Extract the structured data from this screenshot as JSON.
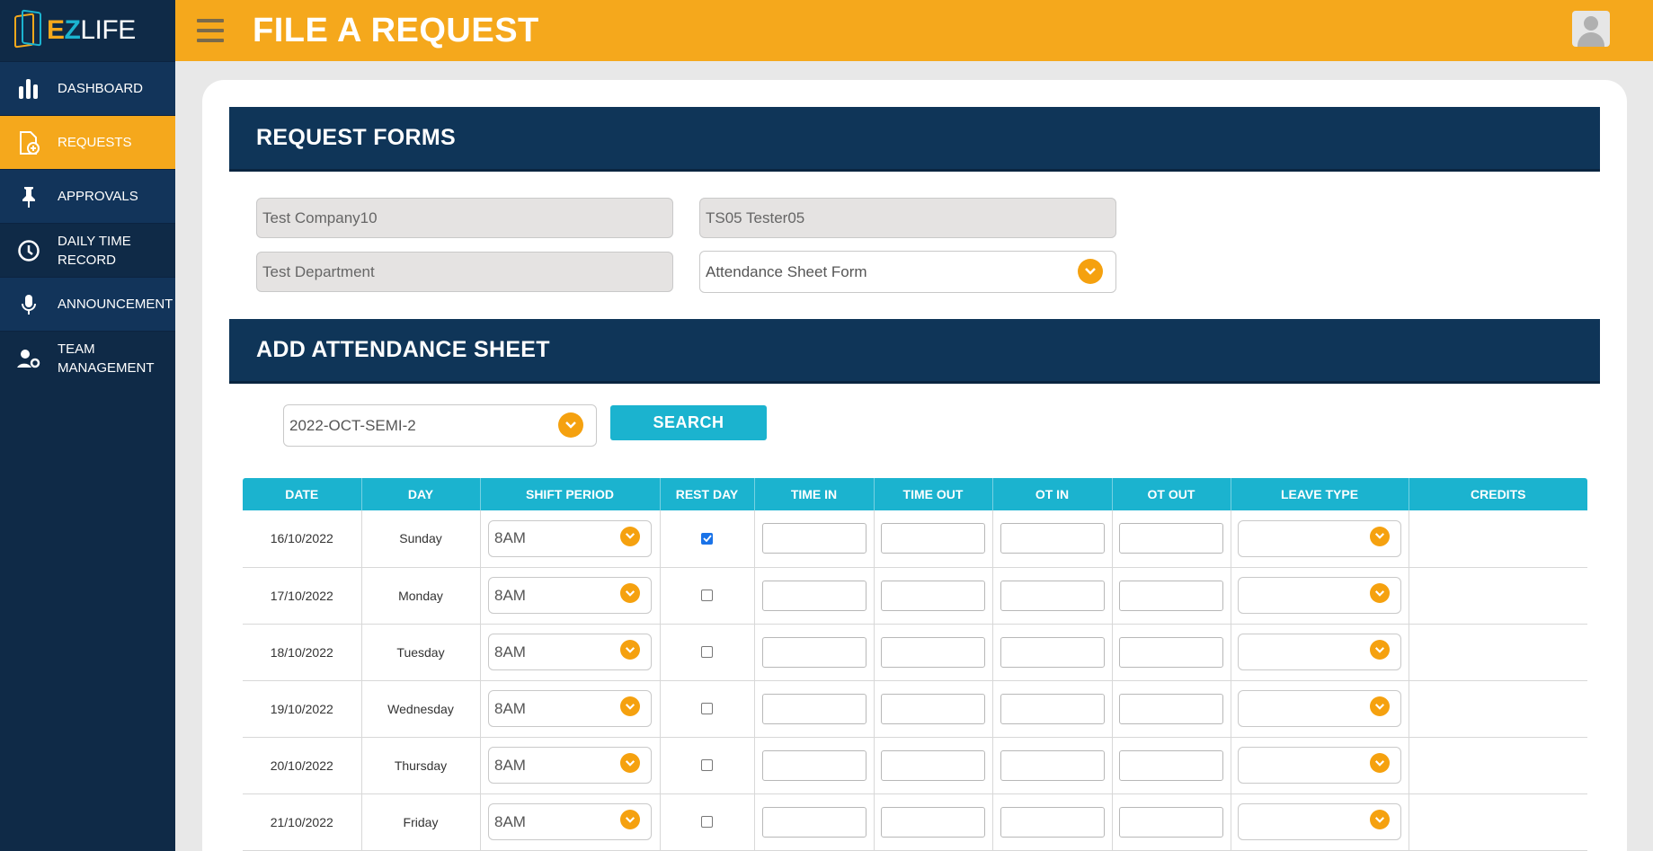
{
  "app": {
    "logo_e": "E",
    "logo_z": "Z",
    "logo_rest": "LIFE"
  },
  "header": {
    "title": "FILE A REQUEST"
  },
  "sidebar": {
    "items": [
      {
        "label": "DASHBOARD",
        "icon": "bar-chart-icon"
      },
      {
        "label": "REQUESTS",
        "icon": "document-add-icon"
      },
      {
        "label": "APPROVALS",
        "icon": "pin-icon"
      },
      {
        "label": "DAILY TIME RECORD",
        "icon": "clock-icon"
      },
      {
        "label": "ANNOUNCEMENT",
        "icon": "microphone-icon"
      },
      {
        "label": "TEAM MANAGEMENT",
        "icon": "user-gear-icon"
      }
    ]
  },
  "request_forms": {
    "title": "REQUEST FORMS",
    "company": "Test Company10",
    "employee": "TS05 Tester05",
    "department": "Test Department",
    "form_type": "Attendance Sheet Form"
  },
  "attendance": {
    "title": "ADD ATTENDANCE SHEET",
    "period": "2022-OCT-SEMI-2",
    "search_label": "SEARCH",
    "columns": [
      "DATE",
      "DAY",
      "SHIFT PERIOD",
      "REST DAY",
      "TIME IN",
      "TIME OUT",
      "OT IN",
      "OT OUT",
      "LEAVE TYPE",
      "CREDITS"
    ],
    "rows": [
      {
        "date": "16/10/2022",
        "day": "Sunday",
        "shift": "8AM",
        "rest_day": true
      },
      {
        "date": "17/10/2022",
        "day": "Monday",
        "shift": "8AM",
        "rest_day": false
      },
      {
        "date": "18/10/2022",
        "day": "Tuesday",
        "shift": "8AM",
        "rest_day": false
      },
      {
        "date": "19/10/2022",
        "day": "Wednesday",
        "shift": "8AM",
        "rest_day": false
      },
      {
        "date": "20/10/2022",
        "day": "Thursday",
        "shift": "8AM",
        "rest_day": false
      },
      {
        "date": "21/10/2022",
        "day": "Friday",
        "shift": "8AM",
        "rest_day": false
      }
    ]
  },
  "colors": {
    "accent": "#f5a81c",
    "sidebar": "#0f2a47",
    "teal": "#1bb3cf",
    "section": "#0f3558"
  }
}
